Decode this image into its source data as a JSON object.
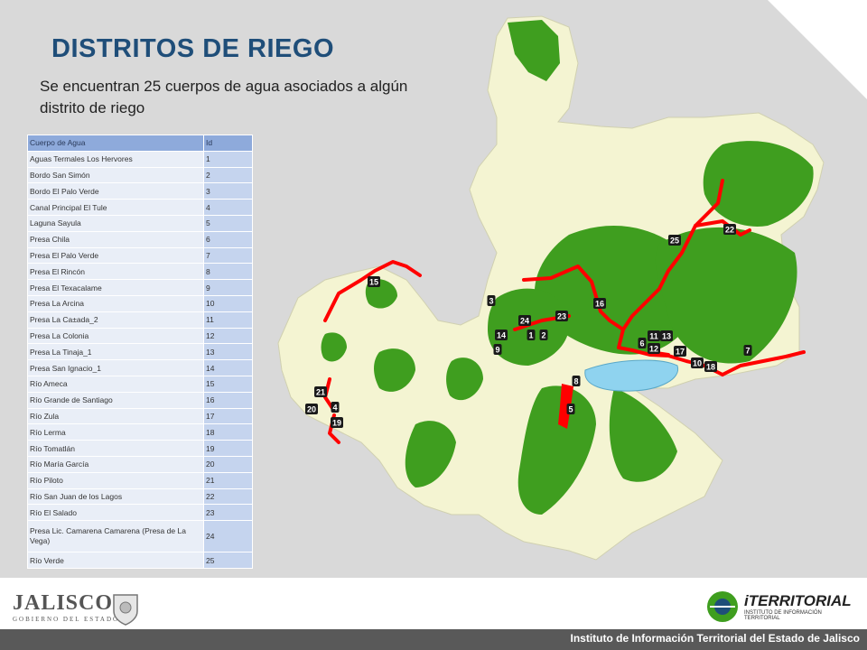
{
  "title": "DISTRITOS DE RIEGO",
  "subtitle": "Se encuentran 25 cuerpos de agua asociados a algún distrito de riego",
  "table": {
    "headers": [
      "Cuerpo de Agua",
      "Id"
    ],
    "rows": [
      {
        "name": "Aguas Termales Los Hervores",
        "id": "1"
      },
      {
        "name": "Bordo San Simón",
        "id": "2"
      },
      {
        "name": "Bordo El Palo Verde",
        "id": "3"
      },
      {
        "name": "Canal Principal El Tule",
        "id": "4"
      },
      {
        "name": "Laguna Sayula",
        "id": "5"
      },
      {
        "name": "Presa Chila",
        "id": "6"
      },
      {
        "name": "Presa El Palo Verde",
        "id": "7"
      },
      {
        "name": "Presa El Rincón",
        "id": "8"
      },
      {
        "name": "Presa El Texacalame",
        "id": "9"
      },
      {
        "name": "Presa La Arcina",
        "id": "10"
      },
      {
        "name": "Presa La Ca±ada_2",
        "id": "11"
      },
      {
        "name": "Presa La Colonia",
        "id": "12"
      },
      {
        "name": "Presa La Tinaja_1",
        "id": "13"
      },
      {
        "name": "Presa San Ignacio_1",
        "id": "14"
      },
      {
        "name": "Río Ameca",
        "id": "15"
      },
      {
        "name": "Río Grande de Santiago",
        "id": "16"
      },
      {
        "name": "Río Zula",
        "id": "17"
      },
      {
        "name": "Río Lerma",
        "id": "18"
      },
      {
        "name": "Río Tomatlán",
        "id": "19"
      },
      {
        "name": "Río María García",
        "id": "20"
      },
      {
        "name": "Río Piloto",
        "id": "21"
      },
      {
        "name": "Río San Juan de los Lagos",
        "id": "22"
      },
      {
        "name": "Río El Salado",
        "id": "23"
      },
      {
        "name": "Presa Lic. Camarena Camarena (Presa de La Vega)",
        "id": "24"
      },
      {
        "name": "Río Verde",
        "id": "25"
      }
    ]
  },
  "map": {
    "colors": {
      "land": "#f4f4d2",
      "irrigation": "#3f9e1f",
      "river": "#ff0000",
      "lake": "#8fd3ef",
      "label_bg": "#1a1a1a"
    },
    "markers": [
      "1",
      "2",
      "3",
      "4",
      "5",
      "6",
      "7",
      "8",
      "9",
      "10",
      "11",
      "12",
      "13",
      "14",
      "15",
      "16",
      "17",
      "18",
      "19",
      "20",
      "21",
      "22",
      "23",
      "24",
      "25"
    ]
  },
  "footer": {
    "institute": "Instituto de Información Territorial del Estado de Jalisco",
    "left_logo_name": "JALISCO",
    "left_logo_sub": "GOBIERNO DEL ESTADO",
    "right_logo_name": "iTERRITORIAL",
    "right_logo_sub": "INSTITUTO DE INFORMACIÓN TERRITORIAL"
  }
}
